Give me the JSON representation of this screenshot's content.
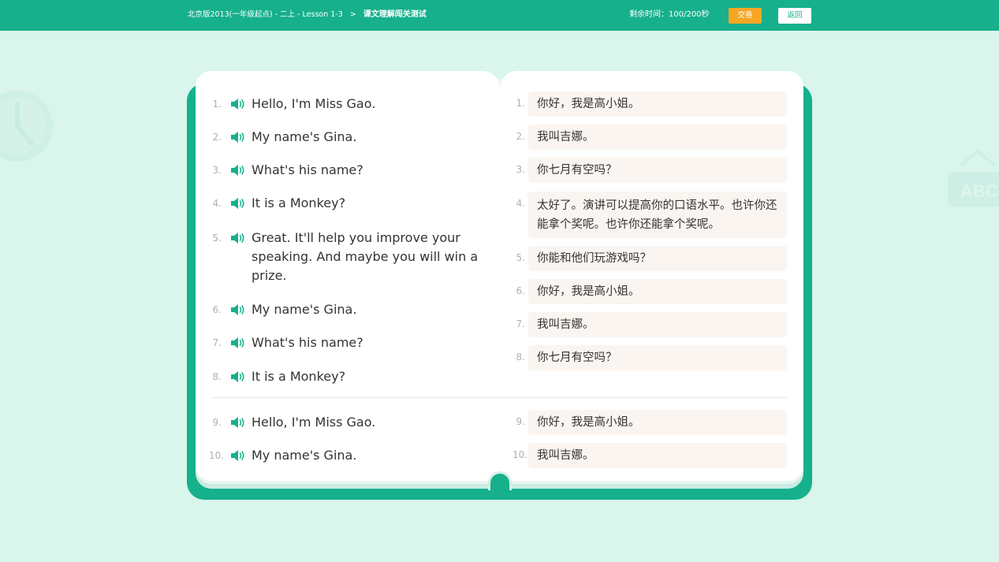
{
  "header": {
    "breadcrumb_book": "北京版2013(一年级起点) - 二上 - Lesson 1-3",
    "breadcrumb_sep": ">",
    "breadcrumb_current": "课文理解闯关测试",
    "timer_label": "剩余时间：",
    "timer_value": "100/200秒",
    "submit_label": "交卷",
    "back_label": "返回"
  },
  "decor": {
    "abc_text": "ABC"
  },
  "colors": {
    "primary": "#16b08c",
    "accent": "#f6a623",
    "background": "#d9f5ec",
    "answer_box": "#faf5f0"
  },
  "english": [
    {
      "num": "1.",
      "text": "Hello, I'm Miss Gao."
    },
    {
      "num": "2.",
      "text": "My name's Gina."
    },
    {
      "num": "3.",
      "text": "What's his name?"
    },
    {
      "num": "4.",
      "text": "It is a Monkey?"
    },
    {
      "num": "5.",
      "text": "Great. It'll help you improve your speaking. And maybe you will win a prize."
    },
    {
      "num": "6.",
      "text": "My name's Gina."
    },
    {
      "num": "7.",
      "text": "What's his name?"
    },
    {
      "num": "8.",
      "text": "It is a Monkey?"
    },
    {
      "num": "9.",
      "text": "Hello, I'm Miss Gao."
    },
    {
      "num": "10.",
      "text": "My name's Gina."
    }
  ],
  "chinese": [
    {
      "num": "1.",
      "text": "你好，我是高小姐。"
    },
    {
      "num": "2.",
      "text": "我叫吉娜。"
    },
    {
      "num": "3.",
      "text": "你七月有空吗？"
    },
    {
      "num": "4.",
      "text": "太好了。演讲可以提高你的口语水平。也许你还能拿个奖呢。也许你还能拿个奖呢。"
    },
    {
      "num": "5.",
      "text": "你能和他们玩游戏吗？"
    },
    {
      "num": "6.",
      "text": "你好，我是高小姐。"
    },
    {
      "num": "7.",
      "text": "我叫吉娜。"
    },
    {
      "num": "8.",
      "text": "你七月有空吗？"
    },
    {
      "num": "9.",
      "text": "你好，我是高小姐。"
    },
    {
      "num": "10.",
      "text": "我叫吉娜。"
    }
  ],
  "icons": {
    "speaker": "speaker-icon",
    "clock": "clock-icon",
    "abc": "abc-sign-icon"
  }
}
